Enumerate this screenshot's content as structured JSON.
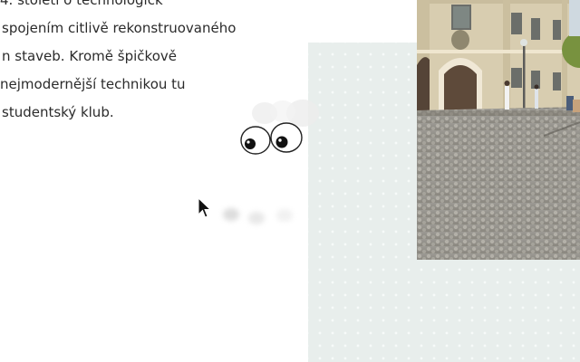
{
  "article": {
    "lines": [
      "4. století o technologick",
      "spojením citlivě rekonstruovaného",
      "n staveb. Kromě špičkově",
      "nejmodernější technikou tu",
      "studentský klub."
    ]
  },
  "decor": {
    "eyes_icon": "googly-eyes",
    "cursor_icon": "arrow-pointer",
    "panel_color": "#e8eeec"
  }
}
